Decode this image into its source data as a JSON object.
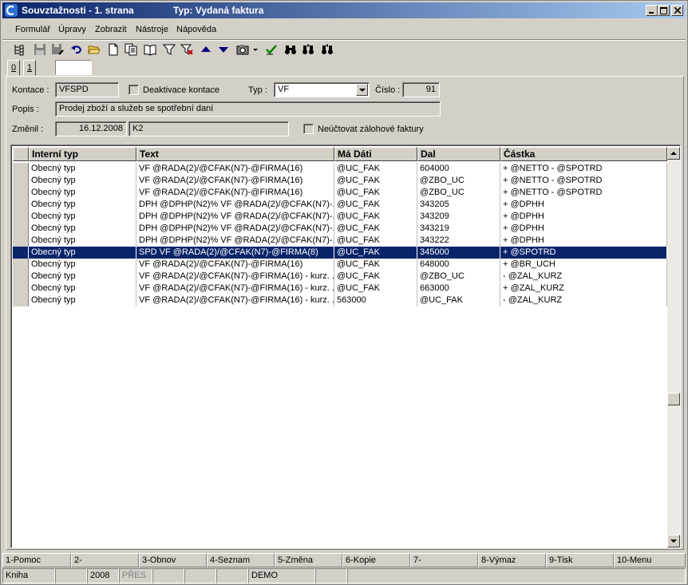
{
  "window": {
    "title": "Souvztažnosti - 1. strana",
    "subtitle": "Typ: Vydaná faktura",
    "minimize": "_",
    "maximize": "□",
    "close": "✕"
  },
  "menu": [
    {
      "label": "Formulář"
    },
    {
      "label": "Úpravy"
    },
    {
      "label": "Zobrazit"
    },
    {
      "label": "Nástroje"
    },
    {
      "label": "Nápověda"
    }
  ],
  "toolbar_icons": [
    "tree-icon",
    "save-icon",
    "save-as-icon",
    "undo-icon",
    "open-folder-icon",
    "new-document-icon",
    "copy-icon",
    "book-icon",
    "filter-icon",
    "filter-remove-icon",
    "arrow-up-icon",
    "arrow-down-icon",
    "camera-icon",
    "dropdown-arrow-icon",
    "check-tool-icon",
    "binoculars-icon",
    "binoculars-next-icon",
    "binoculars-prev-icon"
  ],
  "tabs": [
    {
      "label": "0"
    },
    {
      "label": "1"
    }
  ],
  "form": {
    "kontace_label": "Kontace :",
    "kontace_value": "VFSPD",
    "deaktivace_label": "Deaktivace kontace",
    "typ_label": "Typ :",
    "typ_value": "VF",
    "cislo_label": "Číslo :",
    "cislo_value": "91",
    "popis_label": "Popis :",
    "popis_value": "Prodej zboží a služeb se spotřební daní",
    "zmenil_label": "Změnil :",
    "zmenil_date": "16.12.2008",
    "zmenil_user": "K2",
    "neuctovat_label": "Neúčtovat zálohové faktury"
  },
  "grid": {
    "columns": [
      "Interní typ",
      "Text",
      "Má Dáti",
      "Dal",
      "Částka"
    ],
    "selected_index": 7,
    "rows": [
      [
        "Obecný typ",
        "VF @RADA(2)/@CFAK(N7)-@FIRMA(16)",
        "@UC_FAK",
        "604000",
        "+ @NETTO - @SPOTRD"
      ],
      [
        "Obecný typ",
        "VF @RADA(2)/@CFAK(N7)-@FIRMA(16)",
        "@UC_FAK",
        "@ZBO_UC",
        "+ @NETTO - @SPOTRD"
      ],
      [
        "Obecný typ",
        "VF @RADA(2)/@CFAK(N7)-@FIRMA(16)",
        "@UC_FAK",
        "@ZBO_UC",
        "+ @NETTO - @SPOTRD"
      ],
      [
        "Obecný typ",
        "DPH @DPHP(N2)% VF @RADA(2)/@CFAK(N7)-...",
        "@UC_FAK",
        "343205",
        "+ @DPHH"
      ],
      [
        "Obecný typ",
        "DPH @DPHP(N2)% VF @RADA(2)/@CFAK(N7)-...",
        "@UC_FAK",
        "343209",
        "+ @DPHH"
      ],
      [
        "Obecný typ",
        "DPH @DPHP(N2)% VF @RADA(2)/@CFAK(N7)-...",
        "@UC_FAK",
        "343219",
        "+ @DPHH"
      ],
      [
        "Obecný typ",
        "DPH @DPHP(N2)% VF @RADA(2)/@CFAK(N7)-...",
        "@UC_FAK",
        "343222",
        "+ @DPHH"
      ],
      [
        "Obecný typ",
        "SPD  VF @RADA(2)/@CFAK(N7)-@FIRMA(8)",
        "@UC_FAK",
        "345000",
        "+ @SPOTRD"
      ],
      [
        "Obecný typ",
        "VF @RADA(2)/@CFAK(N7)-@FIRMA(16)",
        "@UC_FAK",
        "648000",
        "+ @BR_UCH"
      ],
      [
        "Obecný typ",
        "VF @RADA(2)/@CFAK(N7)-@FIRMA(16) - kurz. ...",
        "@UC_FAK",
        "@ZBO_UC",
        "- @ZAL_KURZ"
      ],
      [
        "Obecný typ",
        "VF @RADA(2)/@CFAK(N7)-@FIRMA(16) - kurz. ...",
        "@UC_FAK",
        "663000",
        "+ @ZAL_KURZ"
      ],
      [
        "Obecný typ",
        "VF @RADA(2)/@CFAK(N7)-@FIRMA(16) - kurz. ...",
        "563000",
        "@UC_FAK",
        "- @ZAL_KURZ"
      ]
    ]
  },
  "fkeys": [
    "1-Pomoc",
    "2-",
    "3-Obnov",
    "4-Seznam",
    "5-Změna",
    "6-Kopie",
    "7-",
    "8-Výmaz",
    "9-Tisk",
    "10-Menu"
  ],
  "status": {
    "module": "Kniha",
    "year": "2008",
    "pres": "PŘES",
    "mode": "DEMO"
  }
}
